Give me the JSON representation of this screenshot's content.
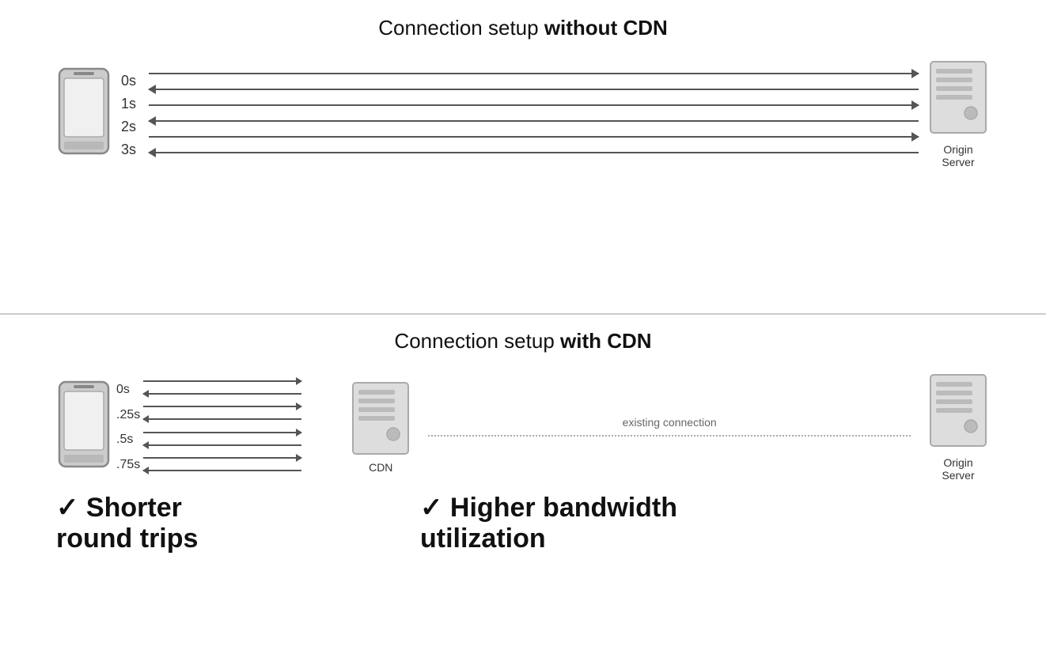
{
  "top_section": {
    "title_normal": "Connection setup ",
    "title_bold": "without CDN",
    "time_labels": [
      "0s",
      "1s",
      "2s",
      "3s"
    ],
    "arrows": [
      {
        "direction": "right"
      },
      {
        "direction": "left"
      },
      {
        "direction": "right"
      },
      {
        "direction": "left"
      },
      {
        "direction": "right"
      },
      {
        "direction": "left"
      }
    ],
    "server_label": "Origin\nServer"
  },
  "bottom_section": {
    "title_normal": "Connection setup ",
    "title_bold": "with CDN",
    "time_labels": [
      "0s",
      ".25s",
      ".5s",
      ".75s"
    ],
    "cdn_arrows": [
      {
        "direction": "right"
      },
      {
        "direction": "left"
      },
      {
        "direction": "right"
      },
      {
        "direction": "left"
      },
      {
        "direction": "right"
      },
      {
        "direction": "left"
      },
      {
        "direction": "right"
      },
      {
        "direction": "left"
      }
    ],
    "cdn_label": "CDN",
    "existing_connection_label": "existing connection",
    "origin_server_label": "Origin\nServer",
    "benefit_left": "✓ Shorter\nround trips",
    "benefit_right": "✓ Higher bandwidth\nutilization"
  }
}
